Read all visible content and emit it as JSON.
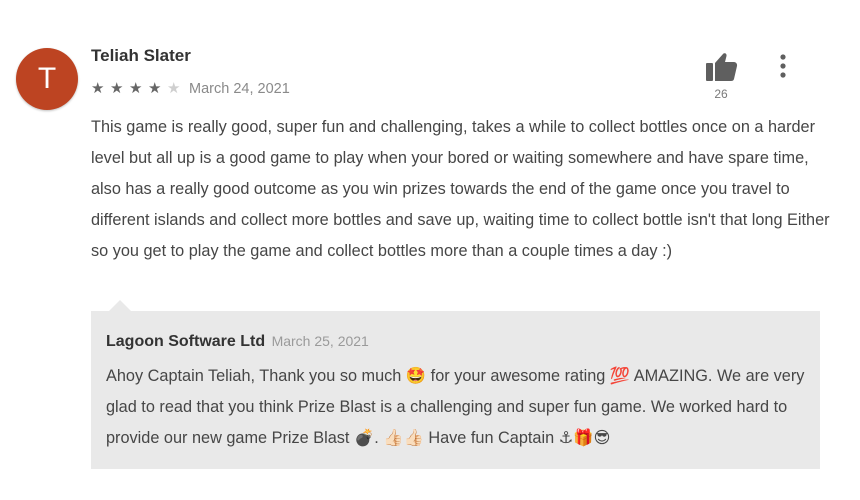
{
  "review": {
    "avatar_letter": "T",
    "author": "Teliah Slater",
    "rating": 4,
    "max_rating": 5,
    "date": "March 24, 2021",
    "helpful_count": "26",
    "body": "This game is really good, super fun and challenging, takes a while to collect bottles once on a harder level but all up is a good game to play when your bored or waiting somewhere and have spare time, also has a really good outcome as you win prizes towards the end of the game once you travel to different islands and collect more bottles and save up, waiting time to collect bottle isn't that long Either so you get to play the game and collect bottles more than a couple times a day :)"
  },
  "reply": {
    "author": "Lagoon Software Ltd",
    "date": "March 25, 2021",
    "body": "Ahoy Captain Teliah, Thank you so much 🤩 for your awesome rating 💯 AMAZING. We are very glad to read that you think Prize Blast is a challenging and super fun game. We worked hard to provide our new game Prize Blast 💣. 👍🏻👍🏻 Have fun Captain ⚓🎁😎"
  },
  "icons": {
    "like": "thumbs-up-icon",
    "more": "more-vert-icon",
    "star_filled": "star-icon",
    "star_empty": "star-empty-icon"
  },
  "colors": {
    "avatar_bg": "#bd4422",
    "reply_bg": "#e9e9e9",
    "star_filled": "#666666",
    "star_empty": "#cfcfcf"
  }
}
